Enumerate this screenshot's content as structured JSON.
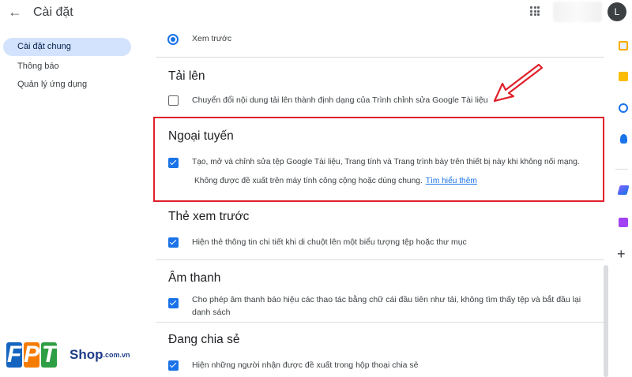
{
  "header": {
    "back_icon": "back-arrow-icon",
    "title": "Cài đặt",
    "avatar_initial": "L"
  },
  "sidebar": {
    "items": [
      {
        "label": "Cài đặt chung",
        "active": true
      },
      {
        "label": "Thông báo",
        "active": false
      },
      {
        "label": "Quản lý ứng dụng",
        "active": false
      }
    ]
  },
  "settings": {
    "preview_option": "Xem trước",
    "upload": {
      "title": "Tải lên",
      "option": "Chuyển đổi nội dung tải lên thành định dạng của Trình chỉnh sửa Google Tài liệu",
      "checked": false
    },
    "offline": {
      "title": "Ngoại tuyến",
      "option": "Tạo, mở và chỉnh sửa tệp Google Tài liệu, Trang tính và Trang trình bày trên thiết bị này khi không nối mạng.",
      "note": "Không được đề xuất trên máy tính công cộng hoặc dùng chung.",
      "link": "Tìm hiểu thêm",
      "checked": true
    },
    "preview_card": {
      "title": "Thẻ xem trước",
      "option": "Hiện thẻ thông tin chi tiết khi di chuột lên một biểu tượng tệp hoặc thư mục",
      "checked": true
    },
    "sound": {
      "title": "Âm thanh",
      "option_line1": "Cho phép âm thanh báo hiệu các thao tác bằng chữ cái đầu tiên như tải, không tìm thấy tệp và bắt đầu lại",
      "option_line2": "danh sách",
      "checked": true
    },
    "sharing": {
      "title": "Đang chia sẻ",
      "option": "Hiện những người nhận được đề xuất trong hộp thoại chia sẻ",
      "checked": true
    }
  },
  "colors": {
    "accent": "#1a73e8",
    "highlight": "#e0202b",
    "sidebar_active": "#d3e3fd"
  },
  "watermark": {
    "brand_letters": [
      "F",
      "P",
      "T"
    ],
    "shop": "Shop",
    "domain": ".com.vn"
  }
}
